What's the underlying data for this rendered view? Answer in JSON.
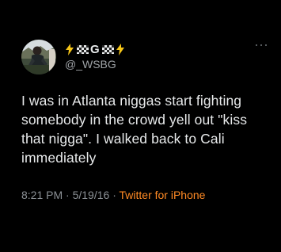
{
  "user": {
    "display_name_part": "G",
    "handle": "@_WSBG",
    "avatar_icon": "profile-photo"
  },
  "tweet": {
    "text": "I was in Atlanta niggas start fighting somebody in the crowd yell out \"kiss that nigga\". I walked back to Cali immediately"
  },
  "meta": {
    "time": "8:21 PM",
    "separator": "·",
    "date": "5/19/16",
    "source": "Twitter for iPhone"
  },
  "icons": {
    "left": "lightning-bolt-icon",
    "checker": "checkered-flag-icon",
    "more": "more-dots-icon"
  },
  "colors": {
    "background": "#000000",
    "text": "#e7e9ea",
    "secondary": "#8b9095",
    "source": "#ff8a24",
    "bolt": "#f5c518"
  }
}
